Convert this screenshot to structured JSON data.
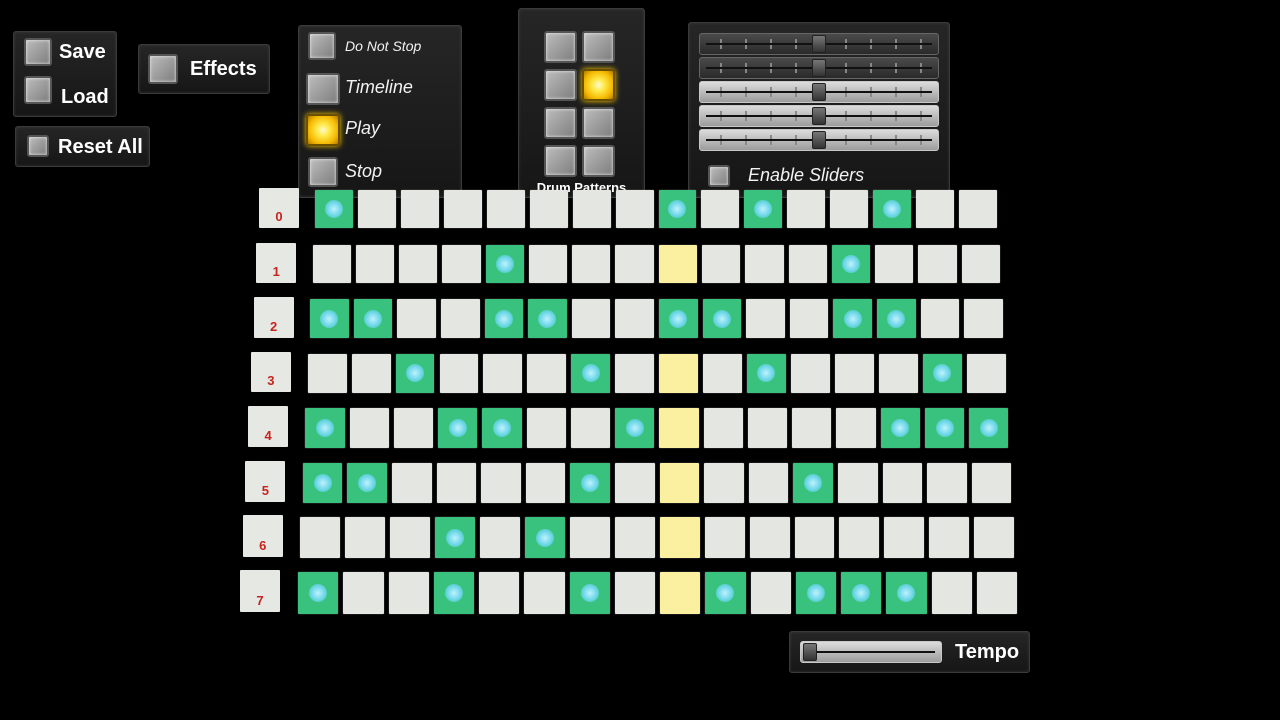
{
  "file_panel": {
    "save_label": "Save",
    "load_label": "Load"
  },
  "effects_label": "Effects",
  "reset_label": "Reset All",
  "transport": {
    "do_not_stop_label": "Do Not Stop",
    "timeline_label": "Timeline",
    "play_label": "Play",
    "stop_label": "Stop",
    "active": "Play"
  },
  "drum_patterns": {
    "label": "Drum Patterns",
    "selected_index": 3
  },
  "sliders_panel": {
    "enable_label": "Enable Sliders",
    "slider_count": 5
  },
  "tempo": {
    "label": "Tempo"
  },
  "sequencer": {
    "steps": 16,
    "playhead_step": 8,
    "row_labels": [
      "0",
      "1",
      "2",
      "3",
      "4",
      "5",
      "6",
      "7"
    ],
    "rows": [
      [
        1,
        0,
        0,
        0,
        0,
        0,
        0,
        0,
        1,
        0,
        1,
        0,
        0,
        1,
        0,
        0
      ],
      [
        0,
        0,
        0,
        0,
        1,
        0,
        0,
        0,
        0,
        0,
        0,
        0,
        1,
        0,
        0,
        0
      ],
      [
        1,
        1,
        0,
        0,
        1,
        1,
        0,
        0,
        1,
        1,
        0,
        0,
        1,
        1,
        0,
        0
      ],
      [
        0,
        0,
        1,
        0,
        0,
        0,
        1,
        0,
        0,
        0,
        1,
        0,
        0,
        0,
        1,
        0
      ],
      [
        1,
        0,
        0,
        1,
        1,
        0,
        0,
        1,
        0,
        0,
        0,
        0,
        0,
        1,
        1,
        1
      ],
      [
        1,
        1,
        0,
        0,
        0,
        0,
        1,
        0,
        0,
        0,
        0,
        1,
        0,
        0,
        0,
        0
      ],
      [
        0,
        0,
        0,
        1,
        0,
        1,
        0,
        0,
        0,
        0,
        0,
        0,
        0,
        0,
        0,
        0
      ],
      [
        1,
        0,
        0,
        1,
        0,
        0,
        1,
        0,
        0,
        1,
        0,
        1,
        1,
        1,
        0,
        0
      ]
    ]
  },
  "colors": {
    "active_cell": "#38c27e",
    "idle_cell": "#e3e6e1",
    "playhead": "#fbf0a0",
    "row_label_text": "#c6241f"
  }
}
